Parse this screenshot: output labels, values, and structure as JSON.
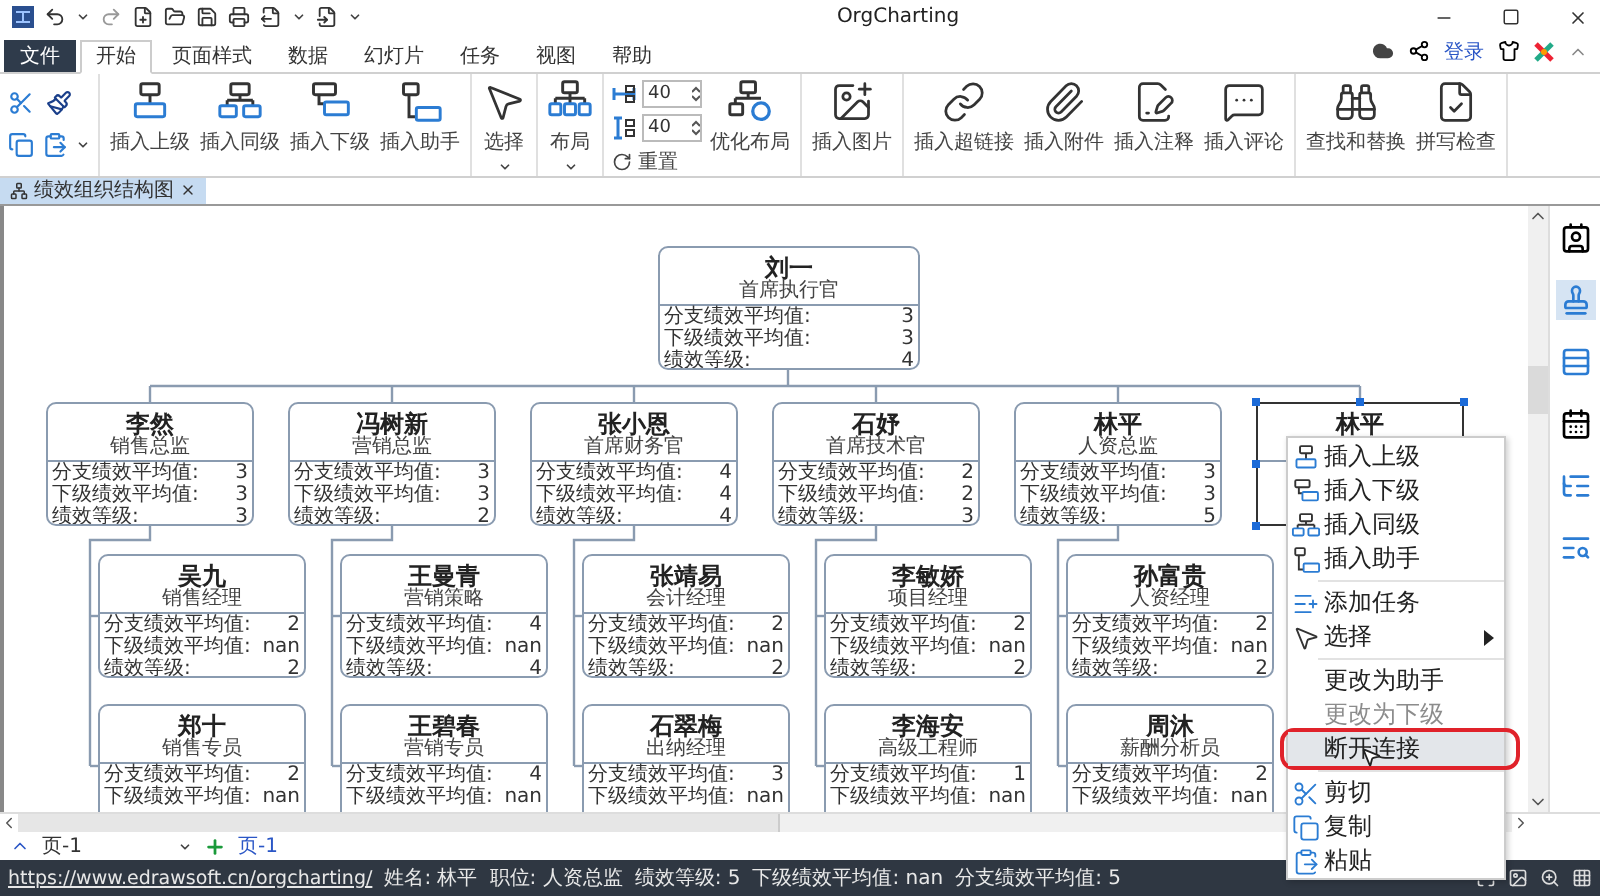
{
  "window": {
    "title": "OrgCharting"
  },
  "tabs": [
    {
      "label": "文件",
      "kind": "file",
      "selected": false
    },
    {
      "label": "开始",
      "kind": "tab",
      "selected": true
    },
    {
      "label": "页面样式",
      "kind": "tab",
      "selected": false
    },
    {
      "label": "数据",
      "kind": "tab",
      "selected": false
    },
    {
      "label": "幻灯片",
      "kind": "tab",
      "selected": false
    },
    {
      "label": "任务",
      "kind": "tab",
      "selected": false
    },
    {
      "label": "视图",
      "kind": "tab",
      "selected": false
    },
    {
      "label": "帮助",
      "kind": "tab",
      "selected": false
    }
  ],
  "login": "登录",
  "ribbon": [
    {
      "items": [
        {
          "kind": "large",
          "label": "插入上级"
        },
        {
          "kind": "large",
          "label": "插入同级"
        },
        {
          "kind": "large",
          "label": "插入下级"
        },
        {
          "kind": "large",
          "label": "插入助手"
        }
      ]
    },
    {
      "items": [
        {
          "kind": "dropdown",
          "label": "选择"
        }
      ]
    },
    {
      "items": [
        {
          "kind": "dropdown",
          "label": "布局"
        }
      ]
    },
    {
      "items": [
        {
          "kind": "spins",
          "values": [
            "40",
            "40"
          ],
          "reset": "重置"
        },
        {
          "kind": "large",
          "label": "优化布局"
        }
      ]
    },
    {
      "items": [
        {
          "kind": "large",
          "label": "插入图片"
        }
      ]
    },
    {
      "items": [
        {
          "kind": "large",
          "label": "插入超链接"
        },
        {
          "kind": "large",
          "label": "插入附件"
        },
        {
          "kind": "large",
          "label": "插入注释"
        },
        {
          "kind": "large",
          "label": "插入评论"
        }
      ]
    },
    {
      "items": [
        {
          "kind": "large",
          "label": "查找和替换"
        },
        {
          "kind": "large",
          "label": "拼写检查"
        }
      ]
    }
  ],
  "doc_tab": {
    "label": "绩效组织结构图"
  },
  "org": {
    "name": "刘一",
    "title": "首席执行官",
    "selected": false,
    "rows": [
      {
        "label": "分支绩效平均值:",
        "value": "3"
      },
      {
        "label": "下级绩效平均值:",
        "value": "3"
      },
      {
        "label": "绩效等级:",
        "value": "4"
      }
    ],
    "children": [
      {
        "name": "李然",
        "title": "销售总监",
        "selected": false,
        "rows": [
          {
            "label": "分支绩效平均值:",
            "value": "3"
          },
          {
            "label": "下级绩效平均值:",
            "value": "3"
          },
          {
            "label": "绩效等级:",
            "value": "3"
          }
        ],
        "children": [
          {
            "name": "吴九",
            "title": "销售经理",
            "selected": false,
            "rows": [
              {
                "label": "分支绩效平均值:",
                "value": "2"
              },
              {
                "label": "下级绩效平均值:",
                "value": "nan"
              },
              {
                "label": "绩效等级:",
                "value": "2"
              }
            ]
          },
          {
            "name": "郑十",
            "title": "销售专员",
            "selected": false,
            "rows": [
              {
                "label": "分支绩效平均值:",
                "value": "2"
              },
              {
                "label": "下级绩效平均值:",
                "value": "nan"
              }
            ]
          }
        ]
      },
      {
        "name": "冯树新",
        "title": "营销总监",
        "selected": false,
        "rows": [
          {
            "label": "分支绩效平均值:",
            "value": "3"
          },
          {
            "label": "下级绩效平均值:",
            "value": "3"
          },
          {
            "label": "绩效等级:",
            "value": "2"
          }
        ],
        "children": [
          {
            "name": "王曼青",
            "title": "营销策略",
            "selected": false,
            "rows": [
              {
                "label": "分支绩效平均值:",
                "value": "4"
              },
              {
                "label": "下级绩效平均值:",
                "value": "nan"
              },
              {
                "label": "绩效等级:",
                "value": "4"
              }
            ]
          },
          {
            "name": "王碧春",
            "title": "营销专员",
            "selected": false,
            "rows": [
              {
                "label": "分支绩效平均值:",
                "value": "4"
              },
              {
                "label": "下级绩效平均值:",
                "value": "nan"
              }
            ]
          }
        ]
      },
      {
        "name": "张小恩",
        "title": "首席财务官",
        "selected": false,
        "rows": [
          {
            "label": "分支绩效平均值:",
            "value": "4"
          },
          {
            "label": "下级绩效平均值:",
            "value": "4"
          },
          {
            "label": "绩效等级:",
            "value": "4"
          }
        ],
        "children": [
          {
            "name": "张靖易",
            "title": "会计经理",
            "selected": false,
            "rows": [
              {
                "label": "分支绩效平均值:",
                "value": "2"
              },
              {
                "label": "下级绩效平均值:",
                "value": "nan"
              },
              {
                "label": "绩效等级:",
                "value": "2"
              }
            ]
          },
          {
            "name": "石翠梅",
            "title": "出纳经理",
            "selected": false,
            "rows": [
              {
                "label": "分支绩效平均值:",
                "value": "3"
              },
              {
                "label": "下级绩效平均值:",
                "value": "nan"
              }
            ]
          }
        ]
      },
      {
        "name": "石妤",
        "title": "首席技术官",
        "selected": false,
        "rows": [
          {
            "label": "分支绩效平均值:",
            "value": "2"
          },
          {
            "label": "下级绩效平均值:",
            "value": "2"
          },
          {
            "label": "绩效等级:",
            "value": "3"
          }
        ],
        "children": [
          {
            "name": "李敏娇",
            "title": "项目经理",
            "selected": false,
            "rows": [
              {
                "label": "分支绩效平均值:",
                "value": "2"
              },
              {
                "label": "下级绩效平均值:",
                "value": "nan"
              },
              {
                "label": "绩效等级:",
                "value": "2"
              }
            ]
          },
          {
            "name": "李海安",
            "title": "高级工程师",
            "selected": false,
            "rows": [
              {
                "label": "分支绩效平均值:",
                "value": "1"
              },
              {
                "label": "下级绩效平均值:",
                "value": "nan"
              }
            ]
          }
        ]
      },
      {
        "name": "林平",
        "title": "人资总监",
        "selected": false,
        "rows": [
          {
            "label": "分支绩效平均值:",
            "value": "3"
          },
          {
            "label": "下级绩效平均值:",
            "value": "3"
          },
          {
            "label": "绩效等级:",
            "value": "5"
          }
        ],
        "children": [
          {
            "name": "孙富贵",
            "title": "人资经理",
            "selected": false,
            "rows": [
              {
                "label": "分支绩效平均值:",
                "value": "2"
              },
              {
                "label": "下级绩效平均值:",
                "value": "nan"
              },
              {
                "label": "绩效等级:",
                "value": "2"
              }
            ]
          },
          {
            "name": "周沐",
            "title": "薪酬分析员",
            "selected": false,
            "rows": [
              {
                "label": "分支绩效平均值:",
                "value": "2"
              },
              {
                "label": "下级绩效平均值:",
                "value": "nan"
              }
            ]
          }
        ]
      },
      {
        "name": "林平",
        "selected": true
      }
    ]
  },
  "context_menu": [
    {
      "kind": "item",
      "label": "插入上级",
      "disabled": false,
      "highlighted": false
    },
    {
      "kind": "item",
      "label": "插入下级",
      "disabled": false,
      "highlighted": false
    },
    {
      "kind": "item",
      "label": "插入同级",
      "disabled": false,
      "highlighted": false
    },
    {
      "kind": "item",
      "label": "插入助手",
      "disabled": false,
      "highlighted": false
    },
    {
      "kind": "separator"
    },
    {
      "kind": "item",
      "label": "添加任务",
      "disabled": false,
      "highlighted": false
    },
    {
      "kind": "item",
      "label": "选择",
      "disabled": false,
      "highlighted": false,
      "submenu": true
    },
    {
      "kind": "separator"
    },
    {
      "kind": "item",
      "label": "更改为助手",
      "disabled": false,
      "highlighted": false
    },
    {
      "kind": "item",
      "label": "更改为下级",
      "disabled": true,
      "highlighted": false
    },
    {
      "kind": "item",
      "label": "断开连接",
      "disabled": false,
      "highlighted": true,
      "circled": true
    },
    {
      "kind": "separator"
    },
    {
      "kind": "item",
      "label": "剪切",
      "disabled": false,
      "highlighted": false
    },
    {
      "kind": "item",
      "label": "复制",
      "disabled": false,
      "highlighted": false
    },
    {
      "kind": "item",
      "label": "粘贴",
      "disabled": false,
      "highlighted": false
    }
  ],
  "page_bar": {
    "page_select": "页-1",
    "page_tab": "页-1"
  },
  "status_bar": {
    "link": "https://www.edrawsoft.cn/orgcharting/",
    "fields": [
      "姓名: 林平",
      "职位: 人资总监",
      "绩效等级: 5",
      "下级绩效平均值: nan",
      "分支绩效平均值: 5"
    ]
  }
}
